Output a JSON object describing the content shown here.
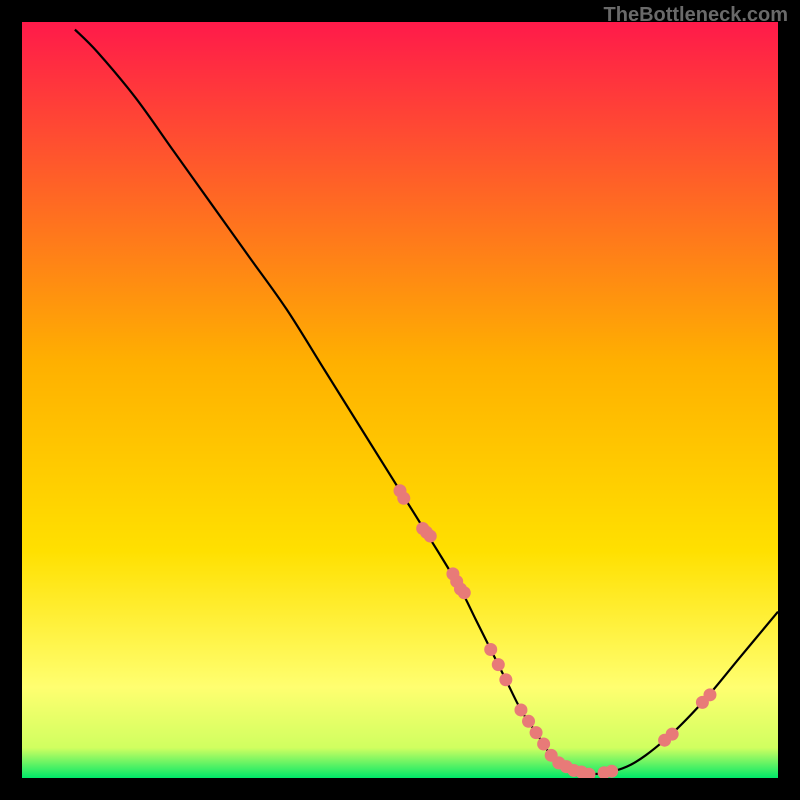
{
  "watermark": "TheBottleneck.com",
  "chart_data": {
    "type": "line",
    "title": "",
    "xlabel": "",
    "ylabel": "",
    "xlim": [
      0,
      100
    ],
    "ylim": [
      0,
      100
    ],
    "gradient_stops": [
      {
        "offset": 0,
        "color": "#ff1a4a"
      },
      {
        "offset": 45,
        "color": "#ffb000"
      },
      {
        "offset": 70,
        "color": "#ffe000"
      },
      {
        "offset": 88,
        "color": "#ffff70"
      },
      {
        "offset": 96,
        "color": "#d0ff60"
      },
      {
        "offset": 100,
        "color": "#00e868"
      }
    ],
    "series": [
      {
        "name": "bottleneck-curve",
        "type": "line",
        "color": "#000000",
        "x": [
          7,
          10,
          15,
          20,
          25,
          30,
          35,
          40,
          45,
          50,
          55,
          58,
          60,
          62,
          64,
          66,
          68,
          70,
          72,
          75,
          80,
          85,
          90,
          95,
          100
        ],
        "y": [
          99,
          96,
          90,
          83,
          76,
          69,
          62,
          54,
          46,
          38,
          30,
          25,
          21,
          17,
          13,
          9,
          6,
          3,
          1.5,
          0.5,
          1.5,
          5,
          10,
          16,
          22
        ]
      },
      {
        "name": "data-points",
        "type": "scatter",
        "color": "#e87a78",
        "x": [
          50,
          50.5,
          53,
          53.5,
          54,
          57,
          57.5,
          58,
          58.5,
          62,
          63,
          64,
          66,
          67,
          68,
          69,
          70,
          71,
          72,
          73,
          74,
          75,
          77,
          78,
          85,
          86,
          90,
          91
        ],
        "y": [
          38,
          37,
          33,
          32.5,
          32,
          27,
          26,
          25,
          24.5,
          17,
          15,
          13,
          9,
          7.5,
          6,
          4.5,
          3,
          2,
          1.5,
          1,
          0.8,
          0.5,
          0.7,
          0.9,
          5,
          5.8,
          10,
          11
        ]
      }
    ]
  }
}
